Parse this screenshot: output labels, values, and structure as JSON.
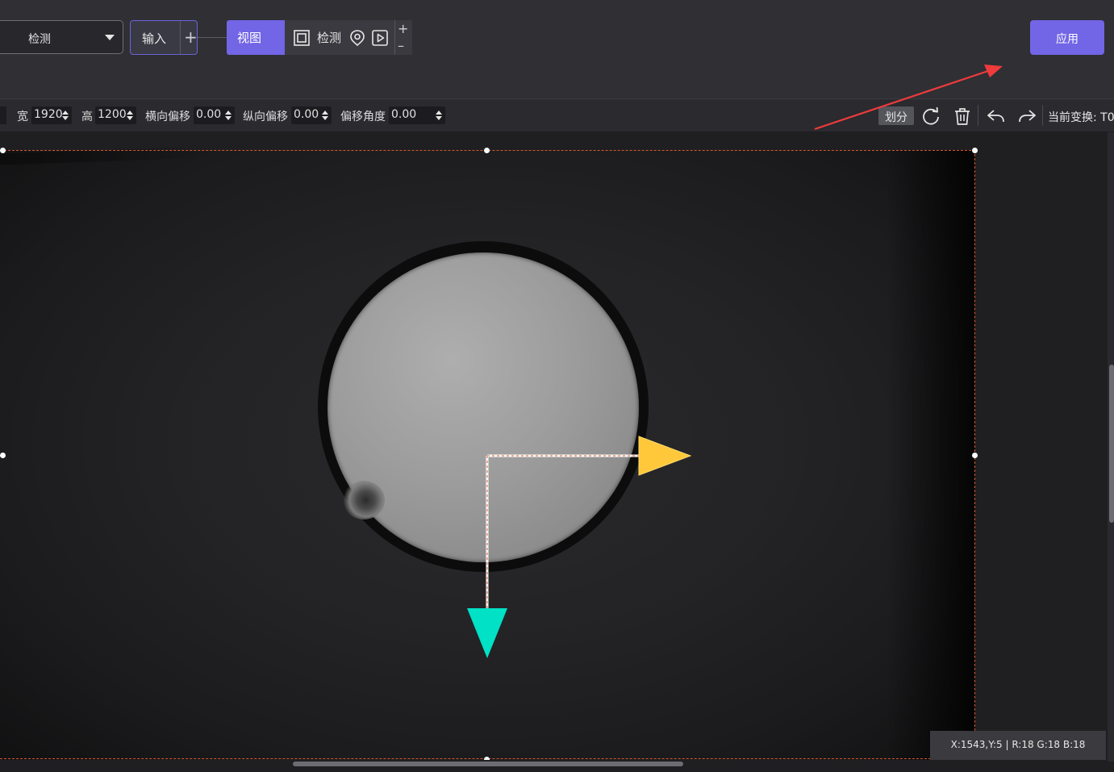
{
  "top": {
    "mode_select": "检测",
    "input_label": "输入",
    "input_add": "+",
    "view_label": "视图",
    "detect_label": "检测",
    "zoom_in": "+",
    "zoom_out": "–",
    "apply_label": "应用"
  },
  "params": {
    "width_label": "宽",
    "width_value": "1920",
    "height_label": "高",
    "height_value": "1200",
    "h_offset_label": "横向偏移",
    "h_offset_value": "0.00",
    "v_offset_label": "纵向偏移",
    "v_offset_value": "0.00",
    "angle_label": "偏移角度",
    "angle_value": "0.00",
    "divide_label": "划分",
    "current_transform_label": "当前变换: T0"
  },
  "icons": {
    "roi": "crop-frame-icon",
    "pin": "location-pin-icon",
    "play": "play-icon",
    "rotate": "refresh-icon",
    "delete": "trash-icon",
    "undo": "undo-icon",
    "redo": "redo-icon"
  },
  "colors": {
    "accent": "#7265e6",
    "axis_x": "#ffc83a",
    "axis_y": "#00e1c6",
    "selection": "#d2582e",
    "annotation_arrow": "#ef3b3b"
  },
  "status": {
    "pixel_info": "X:1543,Y:5 | R:18 G:18 B:18"
  }
}
